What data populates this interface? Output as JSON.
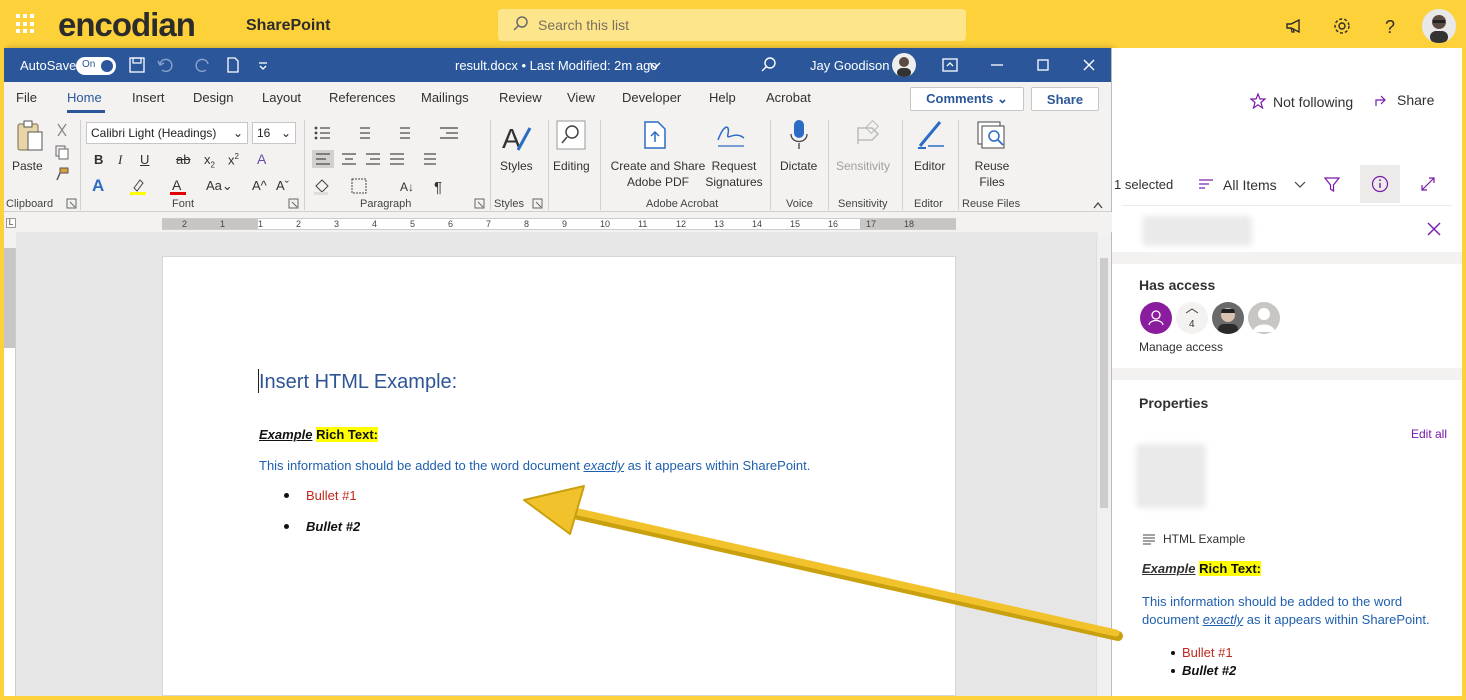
{
  "suite": {
    "brand": "encodian",
    "app": "SharePoint",
    "search_placeholder": "Search this list",
    "icons": [
      "app-launcher-icon",
      "megaphone-icon",
      "settings-icon",
      "help-icon"
    ]
  },
  "word": {
    "autosave_label": "AutoSave",
    "autosave_state": "On",
    "file_title": "result.docx • Last Modified: 2m ago",
    "user": "Jay Goodison",
    "menu_tabs": [
      "File",
      "Home",
      "Insert",
      "Design",
      "Layout",
      "References",
      "Mailings",
      "Review",
      "View",
      "Developer",
      "Help",
      "Acrobat"
    ],
    "comments_label": "Comments",
    "share_label": "Share",
    "ribbon": {
      "paste": "Paste",
      "font_name": "Calibri Light (Headings)",
      "font_size": "16",
      "styles": "Styles",
      "editing": "Editing",
      "create_share_pdf": "Create and Share Adobe PDF",
      "request_signatures": "Request Signatures",
      "dictate": "Dictate",
      "sensitivity": "Sensitivity",
      "editor": "Editor",
      "reuse_files": "Reuse Files",
      "groups": [
        "Clipboard",
        "Font",
        "Paragraph",
        "Styles",
        "Adobe Acrobat",
        "Voice",
        "Sensitivity",
        "Editor",
        "Reuse Files"
      ]
    },
    "ruler_numbers": [
      "2",
      "1",
      "1",
      "2",
      "3",
      "4",
      "5",
      "6",
      "7",
      "8",
      "9",
      "10",
      "11",
      "12",
      "13",
      "14",
      "15",
      "16",
      "17",
      "18"
    ],
    "document": {
      "heading": "Insert HTML Example:",
      "rich_label_em": "Example",
      "rich_label_hl": "Rich Text:",
      "para_before": "This information should be added to the word document ",
      "para_em": "exactly",
      "para_after": " as it appears within SharePoint.",
      "bullets": [
        "Bullet #1",
        "Bullet #2"
      ]
    }
  },
  "sharepoint": {
    "not_following": "Not following",
    "share": "Share",
    "selected": "1 selected",
    "view": "All Items",
    "has_access": "Has access",
    "access_count": "4",
    "manage_access": "Manage access",
    "properties": "Properties",
    "edit_all": "Edit all",
    "field_name": "HTML Example",
    "rich_label_em": "Example",
    "rich_label_hl": "Rich Text:",
    "para_before": "This information should be added to the word document ",
    "para_em": "exactly",
    "para_after": " as it appears within SharePoint.",
    "bullets": [
      "Bullet #1",
      "Bullet #2"
    ]
  },
  "colors": {
    "frame": "#fdd13a",
    "word_blue": "#2b579a",
    "doc_heading": "#2f5496",
    "doc_text_blue": "#1f5fae",
    "bullet_red": "#c0281d",
    "sp_purple": "#7719aa",
    "arrow": "#f2c22d"
  }
}
